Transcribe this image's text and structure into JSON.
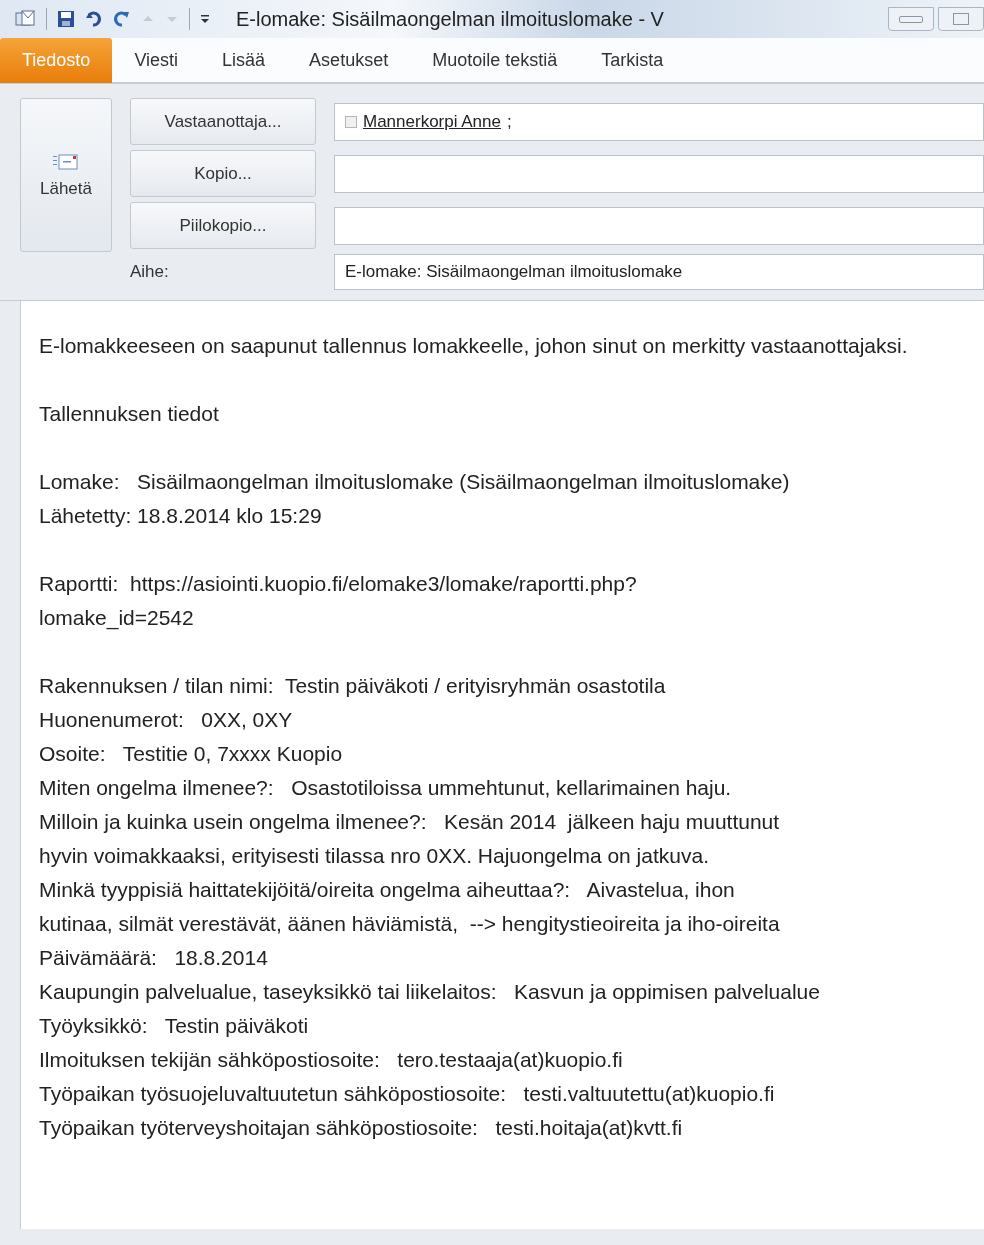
{
  "window": {
    "title": "E-lomake: Sisäilmaongelman ilmoituslomake  -  V"
  },
  "tabs": [
    {
      "label": "Tiedosto",
      "selected": true
    },
    {
      "label": "Viesti",
      "selected": false
    },
    {
      "label": "Lisää",
      "selected": false
    },
    {
      "label": "Asetukset",
      "selected": false
    },
    {
      "label": "Muotoile tekstiä",
      "selected": false
    },
    {
      "label": "Tarkista",
      "selected": false
    }
  ],
  "send_button": {
    "label": "Lähetä"
  },
  "address_rows": [
    {
      "button": "Vastaanottaja...",
      "recipient": "Mannerkorpi Anne",
      "separator": ";"
    },
    {
      "button": "Kopio..."
    },
    {
      "button": "Piilokopio..."
    }
  ],
  "subject": {
    "label": "Aihe:",
    "value": "E-lomake: Sisäilmaongelman ilmoituslomake"
  },
  "body": [
    [
      "E-lomakkeeseen on saapunut tallennus lomakkeelle, johon sinut on merkitty vastaanottajaksi."
    ],
    [
      "Tallennuksen tiedot"
    ],
    [
      "Lomake:   Sisäilmaongelman ilmoituslomake (Sisäilmaongelman ilmoituslomake)",
      "Lähetetty: 18.8.2014 klo 15:29"
    ],
    [
      "Raportti:  https://asiointi.kuopio.fi/elomake3/lomake/raportti.php?\nlomake_id=2542"
    ],
    [
      "Rakennuksen / tilan nimi:  Testin päiväkoti / erityisryhmän osastotila",
      "Huonenumerot:   0XX, 0XY",
      "Osoite:   Testitie 0, 7xxxx Kuopio",
      "Miten ongelma ilmenee?:   Osastotiloissa ummehtunut, kellarimainen haju.",
      "Milloin ja kuinka usein ongelma ilmenee?:   Kesän 2014  jälkeen haju muuttunut\nhyvin voimakkaaksi, erityisesti tilassa nro 0XX. Hajuongelma on jatkuva.",
      "Minkä tyyppisiä haittatekijöitä/oireita ongelma aiheuttaa?:   Aivastelua, ihon\nkutinaa, silmät verestävät, äänen häviämistä,  --> hengitystieoireita ja iho-oireita",
      "Päivämäärä:   18.8.2014",
      "Kaupungin palvelualue, taseyksikkö tai liikelaitos:   Kasvun ja oppimisen palvelualue",
      "Työyksikkö:   Testin päiväkoti",
      "Ilmoituksen tekijän sähköpostiosoite:   tero.testaaja(at)kuopio.fi",
      "Työpaikan työsuojeluvaltuutetun sähköpostiosoite:   testi.valtuutettu(at)kuopio.fi",
      "Työpaikan työterveyshoitajan sähköpostiosoite:   testi.hoitaja(at)kvtt.fi"
    ]
  ]
}
